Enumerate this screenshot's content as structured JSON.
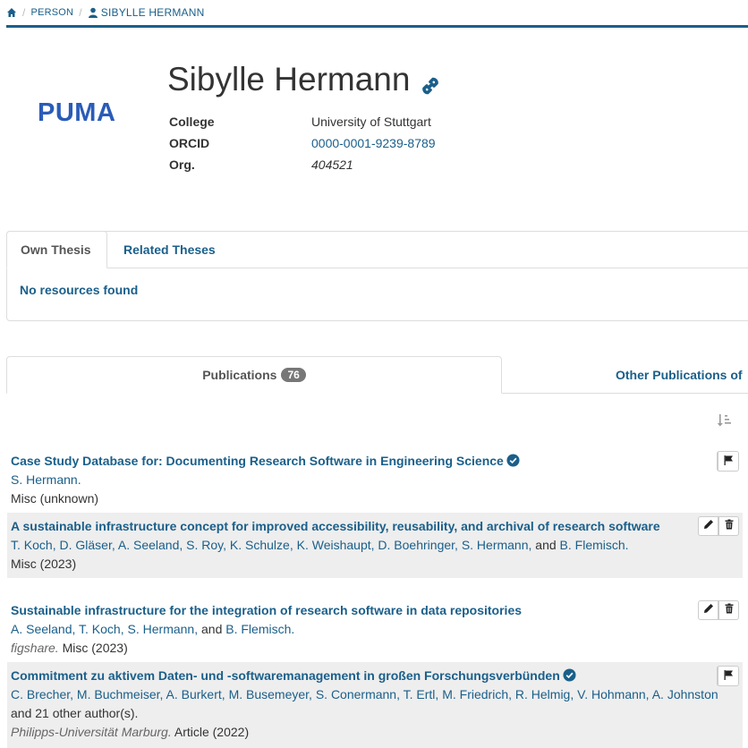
{
  "breadcrumb": {
    "person": "PERSON",
    "current": "SIBYLLE HERMANN"
  },
  "logo": "PUMA",
  "person": {
    "name": "Sibylle Hermann",
    "fields": [
      {
        "label": "College",
        "value": "University of Stuttgart"
      },
      {
        "label": "ORCID",
        "value": "0000-0001-9239-8789"
      },
      {
        "label": "Org.",
        "value": "404521"
      }
    ]
  },
  "thesis_tabs": {
    "own": "Own Thesis",
    "related": "Related Theses",
    "empty_message": "No resources found"
  },
  "publication_tabs": {
    "publications": "Publications",
    "publications_count": "76",
    "other": "Other Publications of"
  },
  "publications": [
    {
      "title": "Case Study Database for: Documenting Research Software in Engineering Science",
      "authors": [
        "S. Hermann."
      ],
      "authors_suffix": "",
      "venue": "",
      "meta": "Misc (unknown)"
    },
    {
      "title": "A sustainable infrastructure concept for improved accessibility, reusability, and archival of research software",
      "authors": [
        "T. Koch,",
        "D. Gläser,",
        "A. Seeland,",
        "S. Roy,",
        "K. Schulze,",
        "K. Weishaupt,",
        "D. Boehringer,",
        "S. Hermann,"
      ],
      "and_text": "and",
      "last_author": "B. Flemisch.",
      "venue": "",
      "meta": "Misc (2023)"
    },
    {
      "title": "Sustainable infrastructure for the integration of research software in data repositories",
      "authors": [
        "A. Seeland,",
        "T. Koch,",
        "S. Hermann,"
      ],
      "and_text": "and",
      "last_author": "B. Flemisch.",
      "venue": "figshare.",
      "meta": "Misc (2023)"
    },
    {
      "title": "Commitment zu aktivem Daten- und -softwaremanagement in großen Forschungsverbünden",
      "authors": [
        "C. Brecher,",
        "M. Buchmeiser,",
        "A. Burkert,",
        "M. Busemeyer,",
        "S. Conermann,",
        "T. Ertl,",
        "M. Friedrich,",
        "R. Helmig,",
        "V. Hohmann,",
        "A. Johnston"
      ],
      "others_text": "and 21 other author(s).",
      "venue": "Philipps-Universität Marburg.",
      "meta": "Article (2022)"
    }
  ],
  "colors": {
    "accent": "#1a5f8a",
    "logo": "#2a5cb8",
    "row_shade": "#eeeeee",
    "badge": "#777777"
  }
}
